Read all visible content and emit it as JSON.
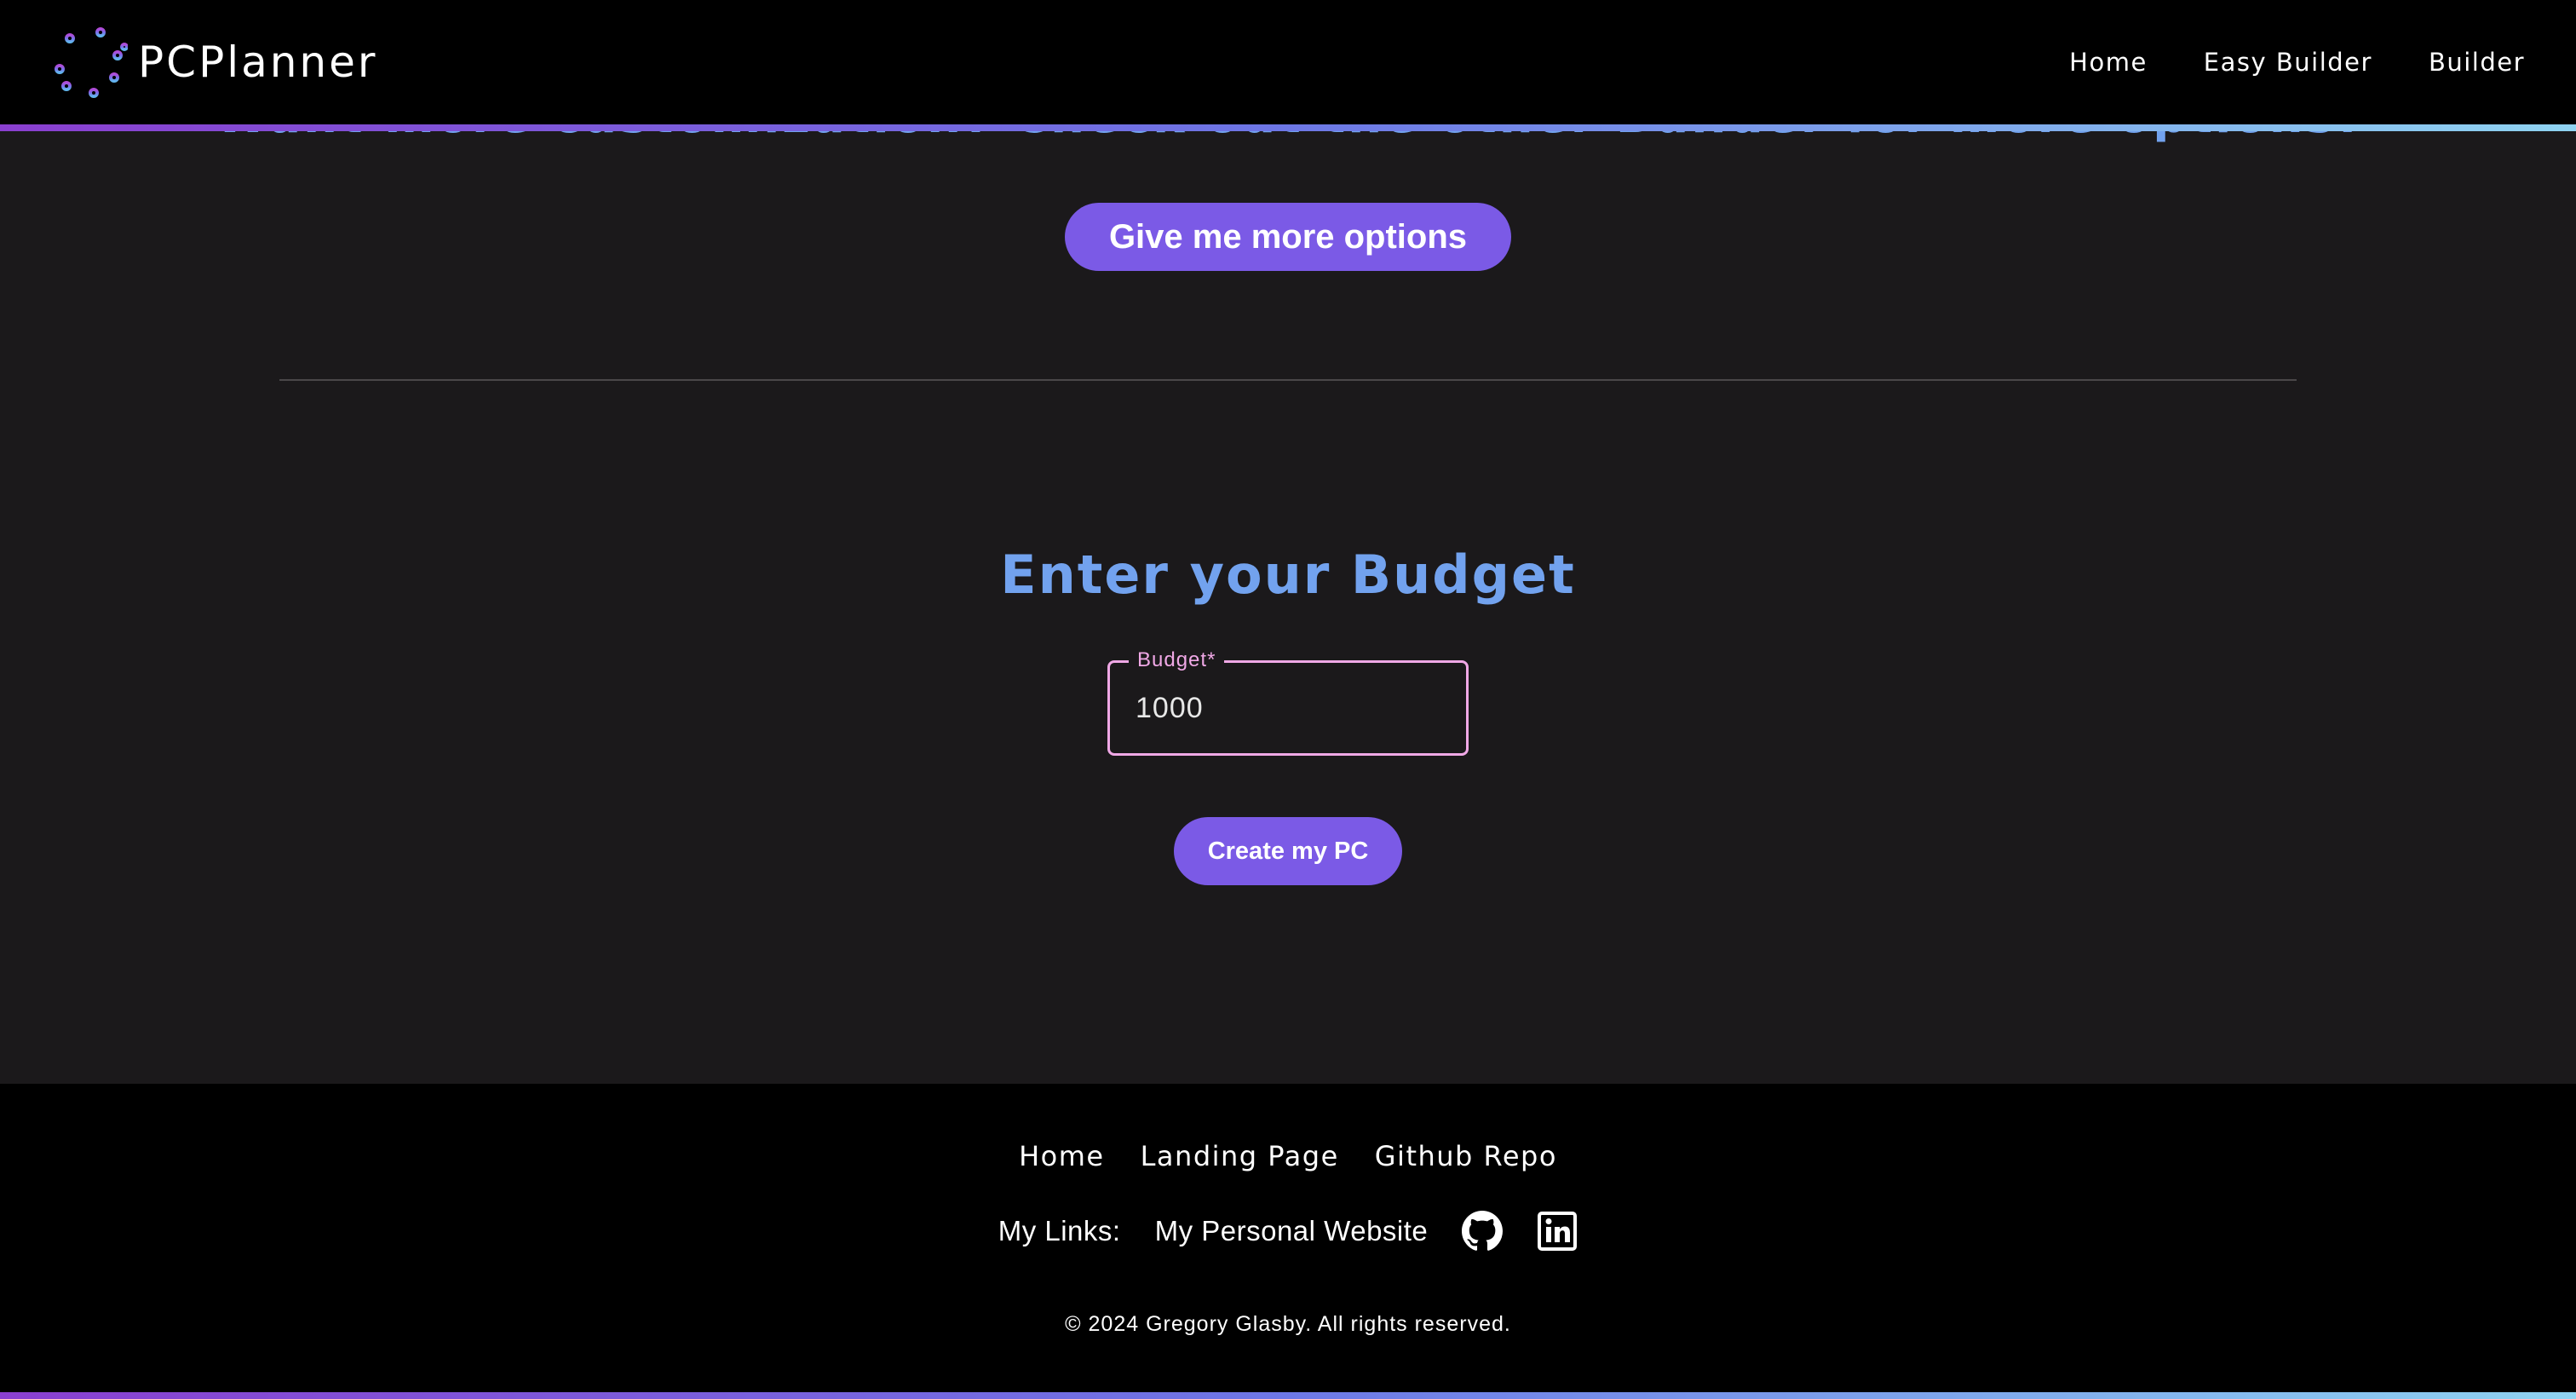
{
  "header": {
    "brand_name": "PCPlanner",
    "logo_icon": "circuit-lines-icon",
    "nav": [
      {
        "label": "Home"
      },
      {
        "label": "Easy Builder"
      },
      {
        "label": "Builder"
      }
    ],
    "accent_gradient": [
      "#8a3fd0",
      "#6d77e6",
      "#8fd3f1"
    ]
  },
  "main": {
    "scrolled_heading": "Want more customization? Check out the other Builder for more options!",
    "more_options_button": "Give me more options",
    "budget_heading": "Enter your Budget",
    "budget_field": {
      "label": "Budget*",
      "value": "1000"
    },
    "create_button": "Create my PC"
  },
  "footer": {
    "nav": [
      {
        "label": "Home"
      },
      {
        "label": "Landing Page"
      },
      {
        "label": "Github Repo"
      }
    ],
    "links_label": "My Links:",
    "personal_website": "My Personal Website",
    "social_icons": [
      "github-icon",
      "linkedin-icon"
    ],
    "copyright": "© 2024 Gregory Glasby. All rights reserved."
  },
  "colors": {
    "background": "#1b191b",
    "header_footer_bg": "#000000",
    "button_bg": "#7b5ae6",
    "heading_blue": "#72a2ee",
    "field_border": "#f0a8e6"
  }
}
